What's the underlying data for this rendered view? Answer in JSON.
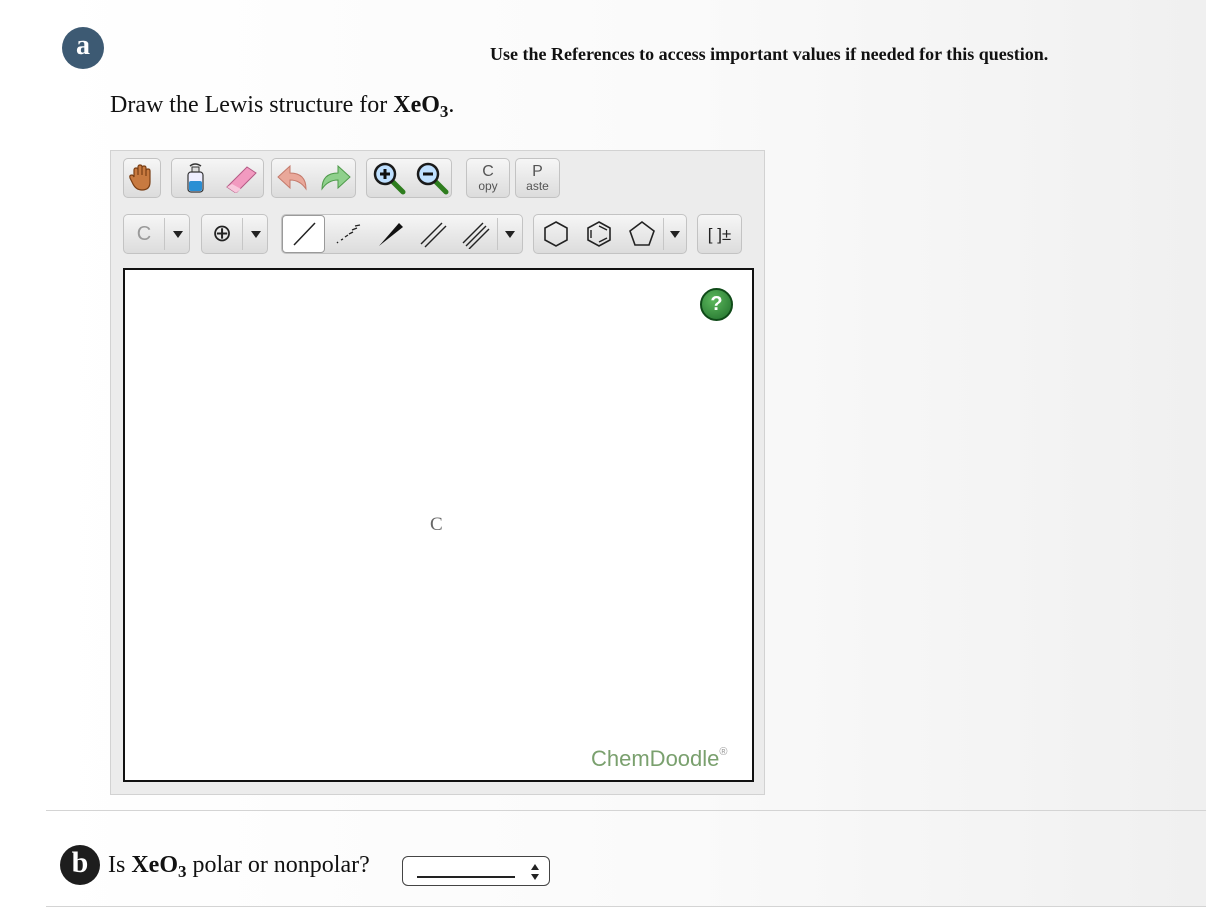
{
  "header": {
    "reference_note": "Use the References to access important values if needed for this question."
  },
  "part_a": {
    "badge": "a",
    "prompt_prefix": "Draw the Lewis structure for ",
    "formula_main": "XeO",
    "formula_sub": "3",
    "prompt_suffix": "."
  },
  "sketcher": {
    "toolbar_row1": [
      {
        "name": "hand-icon"
      },
      {
        "name": "clear-bottle-icon"
      },
      {
        "name": "eraser-icon"
      },
      {
        "name": "undo-icon"
      },
      {
        "name": "redo-icon"
      },
      {
        "name": "zoom-in-icon"
      },
      {
        "name": "zoom-out-icon"
      },
      {
        "name": "copy-icon",
        "top": "C",
        "bottom": "opy"
      },
      {
        "name": "paste-icon",
        "top": "P",
        "bottom": "aste"
      }
    ],
    "atom_label": "C",
    "charge_label": "⊕",
    "bracket_label": "[ ]±",
    "canvas_atom": "C",
    "help_symbol": "?",
    "brand": "ChemDoodle",
    "brand_mark": "®"
  },
  "part_b": {
    "badge": "b",
    "prompt_prefix": "Is ",
    "formula_main": "XeO",
    "formula_sub": "3",
    "prompt_suffix": " polar or nonpolar?",
    "select_value": ""
  }
}
